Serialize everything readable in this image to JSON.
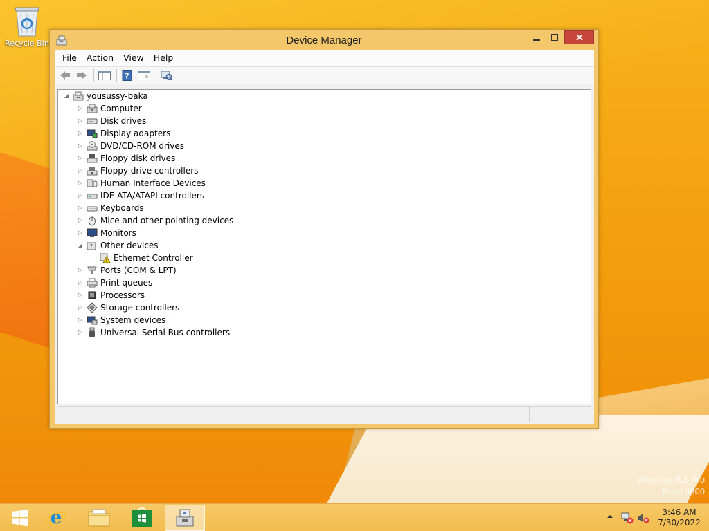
{
  "desktop": {
    "icons": [
      {
        "label": "Recycle Bin",
        "icon": "recycle-bin-icon"
      }
    ],
    "watermark": {
      "line1": "Windows 8.1 Pro",
      "line2": "Build 9600"
    }
  },
  "window": {
    "title": "Device Manager",
    "icon": "device-manager-icon",
    "controls": {
      "minimize": "minimize-icon",
      "maximize": "maximize-icon",
      "close": "close-icon"
    },
    "menu": [
      "File",
      "Action",
      "View",
      "Help"
    ],
    "toolbar": [
      {
        "name": "back",
        "icon": "back-arrow-icon"
      },
      {
        "name": "forward",
        "icon": "forward-arrow-icon"
      },
      {
        "name": "show-hide-console-tree",
        "icon": "console-tree-icon"
      },
      {
        "name": "help",
        "icon": "help-icon"
      },
      {
        "name": "properties",
        "icon": "properties-icon"
      },
      {
        "name": "scan-hardware-changes",
        "icon": "scan-hardware-icon"
      }
    ],
    "tree": {
      "root": {
        "label": "yousussy-baka",
        "icon": "computer-icon",
        "expanded": true
      },
      "categories": [
        {
          "label": "Computer",
          "icon": "computer-icon",
          "expanded": false
        },
        {
          "label": "Disk drives",
          "icon": "disk-drive-icon",
          "expanded": false
        },
        {
          "label": "Display adapters",
          "icon": "display-adapter-icon",
          "expanded": false
        },
        {
          "label": "DVD/CD-ROM drives",
          "icon": "dvd-drive-icon",
          "expanded": false
        },
        {
          "label": "Floppy disk drives",
          "icon": "floppy-drive-icon",
          "expanded": false
        },
        {
          "label": "Floppy drive controllers",
          "icon": "floppy-controller-icon",
          "expanded": false
        },
        {
          "label": "Human Interface Devices",
          "icon": "hid-icon",
          "expanded": false
        },
        {
          "label": "IDE ATA/ATAPI controllers",
          "icon": "ide-controller-icon",
          "expanded": false
        },
        {
          "label": "Keyboards",
          "icon": "keyboard-icon",
          "expanded": false
        },
        {
          "label": "Mice and other pointing devices",
          "icon": "mouse-icon",
          "expanded": false
        },
        {
          "label": "Monitors",
          "icon": "monitor-icon",
          "expanded": false
        },
        {
          "label": "Other devices",
          "icon": "other-devices-icon",
          "expanded": true,
          "children": [
            {
              "label": "Ethernet Controller",
              "icon": "warning-device-icon"
            }
          ]
        },
        {
          "label": "Ports (COM & LPT)",
          "icon": "port-icon",
          "expanded": false
        },
        {
          "label": "Print queues",
          "icon": "printer-icon",
          "expanded": false
        },
        {
          "label": "Processors",
          "icon": "processor-icon",
          "expanded": false
        },
        {
          "label": "Storage controllers",
          "icon": "storage-controller-icon",
          "expanded": false
        },
        {
          "label": "System devices",
          "icon": "system-devices-icon",
          "expanded": false
        },
        {
          "label": "Universal Serial Bus controllers",
          "icon": "usb-icon",
          "expanded": false
        }
      ]
    },
    "statusbar": {
      "cells": [
        "",
        "",
        ""
      ]
    }
  },
  "taskbar": {
    "items": [
      {
        "name": "start",
        "icon": "windows-logo-icon"
      },
      {
        "name": "internet-explorer",
        "icon": "internet-explorer-icon"
      },
      {
        "name": "file-explorer",
        "icon": "file-explorer-icon"
      },
      {
        "name": "store",
        "icon": "store-icon"
      },
      {
        "name": "device-manager",
        "icon": "device-manager-icon",
        "active": true
      }
    ],
    "tray": {
      "icons": [
        "show-hidden-icons-icon",
        "network-error-icon",
        "volume-muted-icon"
      ],
      "time": "3:46 AM",
      "date": "7/30/2022"
    }
  },
  "colors": {
    "accent": "#f3c76a",
    "close_button": "#c7463c",
    "desktop": "#f5a50e",
    "taskbar": "#f2bd4f"
  }
}
